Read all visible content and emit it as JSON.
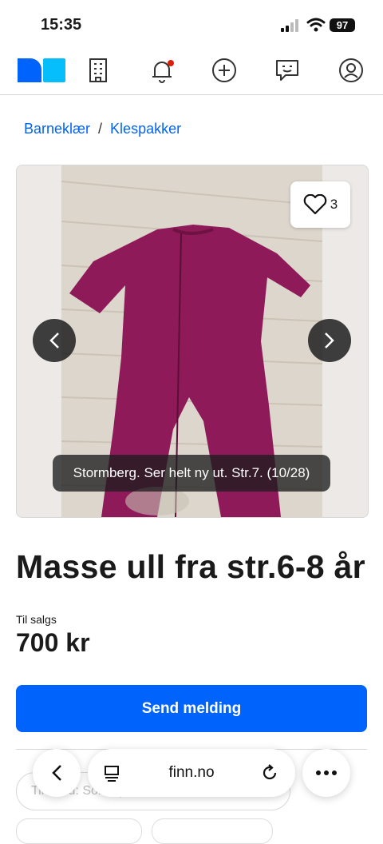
{
  "status_bar": {
    "time": "15:35",
    "battery": "97"
  },
  "icons": {
    "signal": "cellular-signal-icon",
    "wifi": "wifi-icon",
    "logo": "finn-logo",
    "nav": [
      "building-icon",
      "bell-icon",
      "plus-circle-icon",
      "chat-icon",
      "profile-icon"
    ],
    "heart": "heart-icon",
    "prev": "chevron-left-icon",
    "next": "chevron-right-icon",
    "back": "chevron-left-icon",
    "reader": "reader-icon",
    "reload": "reload-icon",
    "more": "ellipsis-icon"
  },
  "colors": {
    "accent": "#0063fb",
    "logo_dark": "#0063fb",
    "logo_light": "#06befb",
    "notification": "#d91f0a",
    "garment": "#8e1a59"
  },
  "breadcrumb": [
    "Barneklær",
    "Klespakker"
  ],
  "gallery": {
    "favorites_count": "3",
    "caption": "Stormberg. Ser helt ny ut. Str.7. (10/28)"
  },
  "listing": {
    "title": "Masse ull fra str.6-8 år",
    "status_label": "Til salgs",
    "price": "700 kr"
  },
  "actions": {
    "send_label": "Send melding"
  },
  "partial_input": "Tilstand: Som ny — liten bruk",
  "browser": {
    "url": "finn.no"
  }
}
